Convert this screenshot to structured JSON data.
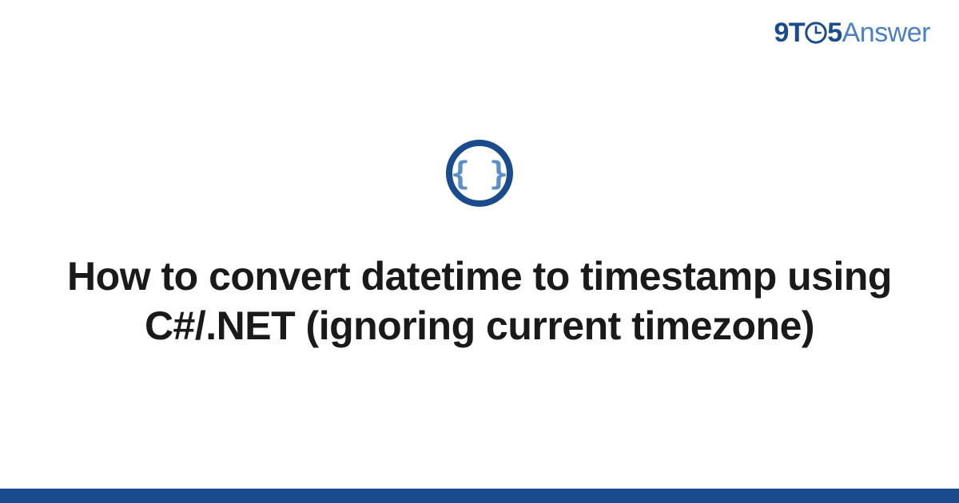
{
  "logo": {
    "part1": "9T",
    "part2": "5",
    "part3": "Answer"
  },
  "icon_name": "curly-braces-icon",
  "title": "How to convert datetime to timestamp using C#/.NET (ignoring current timezone)",
  "colors": {
    "brand_dark": "#1a4b8c",
    "brand_light": "#4a81c4",
    "text": "#1a1a1a"
  }
}
